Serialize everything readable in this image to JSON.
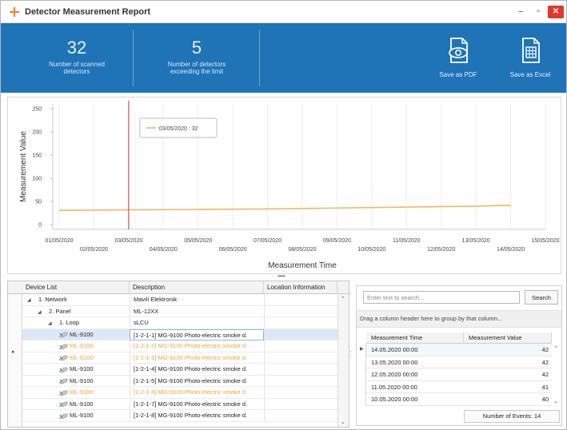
{
  "window": {
    "title": "Detector Measurement Report",
    "minimize": "–",
    "maximize": "▫",
    "close": "✕"
  },
  "ribbon": {
    "stat_scanned": {
      "value": "32",
      "label_line1": "Number of scanned",
      "label_line2": "detectors"
    },
    "stat_exceeding": {
      "value": "5",
      "label_line1": "Number of detectors",
      "label_line2": "exceeding the limit"
    },
    "save_pdf_label": "Save as PDF",
    "save_excel_label": "Save as Excel",
    "accent_color": "#1f73b7"
  },
  "chart_data": {
    "type": "line",
    "xlabel": "Measurement Time",
    "ylabel": "Measurement Value",
    "ylim": [
      -10,
      260
    ],
    "yticks": [
      0,
      50,
      100,
      150,
      200,
      250
    ],
    "x_ticks_top": [
      "01/05/2020",
      "03/05/2020",
      "05/05/2020",
      "07/05/2020",
      "09/05/2020",
      "11/05/2020",
      "13/05/2020",
      "15/05/2020"
    ],
    "x_ticks_bottom": [
      "02/05/2020",
      "04/05/2020",
      "06/05/2020",
      "08/05/2020",
      "10/05/2020",
      "12/05/2020",
      "14/05/2020"
    ],
    "x_dates": [
      "01/05/2020",
      "02/05/2020",
      "03/05/2020",
      "04/05/2020",
      "05/05/2020",
      "06/05/2020",
      "07/05/2020",
      "08/05/2020",
      "09/05/2020",
      "10/05/2020",
      "11/05/2020",
      "12/05/2020",
      "13/05/2020",
      "14/05/2020",
      "15/05/2020"
    ],
    "series": [
      {
        "color": "#f5b85a",
        "x": [
          "01/05/2020",
          "03/05/2020",
          "05/05/2020",
          "07/05/2020",
          "09/05/2020",
          "11/05/2020",
          "13/05/2020",
          "14/05/2020"
        ],
        "values": [
          31,
          32,
          33,
          34,
          36,
          38,
          40,
          42
        ]
      }
    ],
    "cursor_date": "03/05/2020",
    "cursor_color": "#d9302c",
    "tooltip": "03/05/2020 : 32",
    "grid": "vertical"
  },
  "device_list": {
    "headers": {
      "device": "Device List",
      "description": "Description",
      "location": "Location Information"
    },
    "rows": [
      {
        "level": 0,
        "expander": "◢",
        "device": "1. Network",
        "description": "Mavili Elektronik",
        "icon": false,
        "orange": false,
        "selected": false
      },
      {
        "level": 1,
        "expander": "◢",
        "device": "2. Panel",
        "description": "ML-12XX",
        "icon": false,
        "orange": false,
        "selected": false
      },
      {
        "level": 2,
        "expander": "◢",
        "device": "1. Loop",
        "description": "sLCU",
        "icon": false,
        "orange": false,
        "selected": false
      },
      {
        "level": 3,
        "expander": "",
        "device": "ML-9100",
        "description": "[1-2-1-1] MG-9100 Photo-electric smoke d.",
        "icon": true,
        "orange": false,
        "selected": true
      },
      {
        "level": 3,
        "expander": "",
        "device": "ML-9100",
        "description": "[1-2-1-2] MG-9100 Photo-electric smoke d.",
        "icon": true,
        "orange": true,
        "selected": false
      },
      {
        "level": 3,
        "expander": "",
        "device": "ML-9100",
        "description": "[1-2-1-3] MG-9100 Photo-electric smoke d.",
        "icon": true,
        "orange": true,
        "selected": false
      },
      {
        "level": 3,
        "expander": "",
        "device": "ML-9100",
        "description": "[1-2-1-4] MG-9100 Photo-electric smoke d.",
        "icon": true,
        "orange": false,
        "selected": false
      },
      {
        "level": 3,
        "expander": "",
        "device": "ML-9100",
        "description": "[1-2-1-5] MG-9100 Photo-electric smoke d.",
        "icon": true,
        "orange": false,
        "selected": false
      },
      {
        "level": 3,
        "expander": "",
        "device": "ML-9100",
        "description": "[1-2-1-6] MG-9100 Photo-electric smoke d.",
        "icon": true,
        "orange": true,
        "selected": false
      },
      {
        "level": 3,
        "expander": "",
        "device": "ML-9100",
        "description": "[1-2-1-7] MG-9100 Photo-electric smoke d.",
        "icon": true,
        "orange": false,
        "selected": false
      },
      {
        "level": 3,
        "expander": "",
        "device": "ML-9100",
        "description": "[1-2-1-8] MG-9100 Photo-electric smoke d.",
        "icon": true,
        "orange": false,
        "selected": false
      }
    ],
    "orange_color": "#f0a33a"
  },
  "events": {
    "search_placeholder": "Enter text to search...",
    "search_button": "Search",
    "group_hint": "Drag a column header here to group by that column...",
    "headers": {
      "time": "Measurement Time",
      "value": "Measurement Value"
    },
    "rows": [
      {
        "time": "14.05.2020 00:00",
        "value": "42"
      },
      {
        "time": "13.05.2020 00:00",
        "value": "42"
      },
      {
        "time": "12.05.2020 00:00",
        "value": "42"
      },
      {
        "time": "11.05.2020 00:00",
        "value": "41"
      },
      {
        "time": "10.05.2020 00:00",
        "value": "40"
      }
    ],
    "count_label": "Number of Events: 14"
  }
}
